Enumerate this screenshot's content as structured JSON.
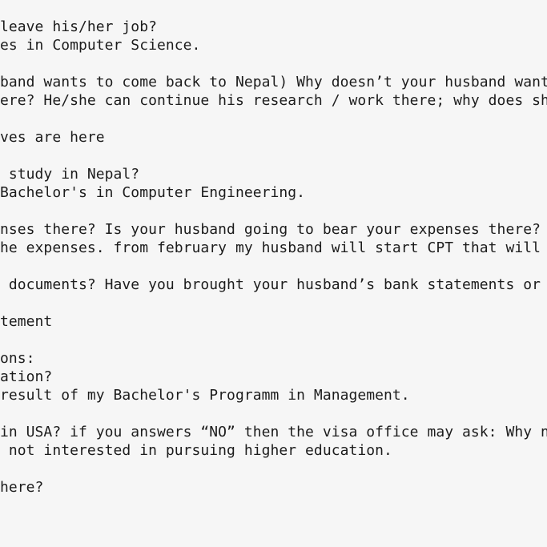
{
  "document": {
    "lines": [
      "leave his/her job?",
      "es in Computer Science.",
      "",
      "band wants to come back to Nepal) Why doesn’t your husband want",
      "ere? He/she can continue his research / work there; why does sh",
      "",
      "ves are here",
      "",
      " study in Nepal?",
      "Bachelor's in Computer Engineering.",
      "",
      "nses there? Is your husband going to bear your expenses there?",
      "he expenses. from february my husband will start CPT that will",
      "",
      " documents? Have you brought your husband’s bank statements or",
      "",
      "tement",
      "",
      "ons:",
      "ation?",
      "result of my Bachelor's Programm in Management.",
      "",
      "in USA? if you answers “NO” then the visa office may ask: Why n",
      " not interested in pursuing higher education.",
      "",
      "here?"
    ]
  }
}
